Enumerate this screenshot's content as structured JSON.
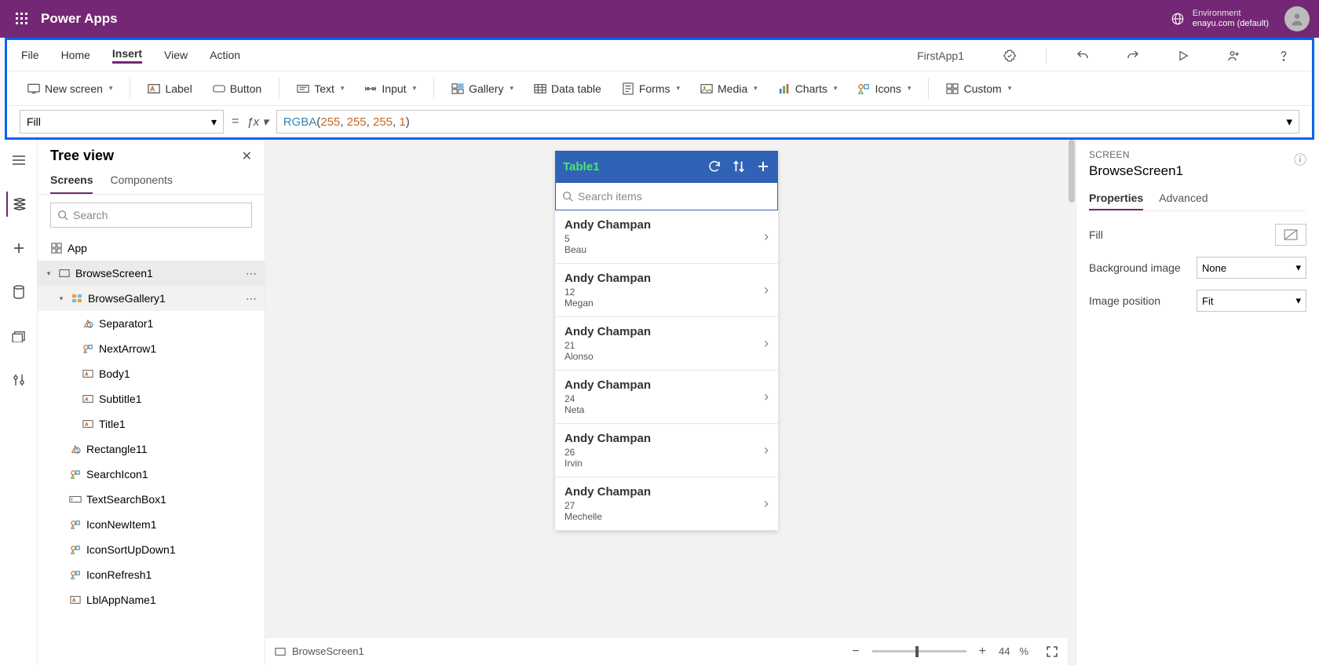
{
  "header": {
    "brand": "Power Apps",
    "env_label": "Environment",
    "env_name": "enayu.com (default)"
  },
  "menu": {
    "tabs": [
      "File",
      "Home",
      "Insert",
      "View",
      "Action"
    ],
    "active": "Insert",
    "app_name": "FirstApp1"
  },
  "ribbon": {
    "new_screen": "New screen",
    "label": "Label",
    "button": "Button",
    "text": "Text",
    "input": "Input",
    "gallery": "Gallery",
    "data_table": "Data table",
    "forms": "Forms",
    "media": "Media",
    "charts": "Charts",
    "icons": "Icons",
    "custom": "Custom"
  },
  "formula": {
    "property": "Fill",
    "fn": "RGBA",
    "a1": "255",
    "a2": "255",
    "a3": "255",
    "a4": "1"
  },
  "tree": {
    "title": "Tree view",
    "tabs": [
      "Screens",
      "Components"
    ],
    "search_ph": "Search",
    "app": "App",
    "items": {
      "browse_screen": "BrowseScreen1",
      "browse_gallery": "BrowseGallery1",
      "separator": "Separator1",
      "next_arrow": "NextArrow1",
      "body": "Body1",
      "subtitle": "Subtitle1",
      "title": "Title1",
      "rectangle": "Rectangle11",
      "search_icon": "SearchIcon1",
      "text_search": "TextSearchBox1",
      "icon_new": "IconNewItem1",
      "icon_sort": "IconSortUpDown1",
      "icon_refresh": "IconRefresh1",
      "lbl_app": "LblAppName1"
    }
  },
  "phone": {
    "title": "Table1",
    "search_ph": "Search items",
    "items": [
      {
        "t1": "Andy Champan",
        "t2": "5",
        "t3": "Beau"
      },
      {
        "t1": "Andy Champan",
        "t2": "12",
        "t3": "Megan"
      },
      {
        "t1": "Andy Champan",
        "t2": "21",
        "t3": "Alonso"
      },
      {
        "t1": "Andy Champan",
        "t2": "24",
        "t3": "Neta"
      },
      {
        "t1": "Andy Champan",
        "t2": "26",
        "t3": "Irvin"
      },
      {
        "t1": "Andy Champan",
        "t2": "27",
        "t3": "Mechelle"
      }
    ]
  },
  "status": {
    "screen": "BrowseScreen1",
    "zoom": "44",
    "pct": "%"
  },
  "props": {
    "section": "SCREEN",
    "name": "BrowseScreen1",
    "tabs": [
      "Properties",
      "Advanced"
    ],
    "fill": "Fill",
    "bg_image": "Background image",
    "bg_val": "None",
    "img_pos": "Image position",
    "img_pos_val": "Fit"
  }
}
